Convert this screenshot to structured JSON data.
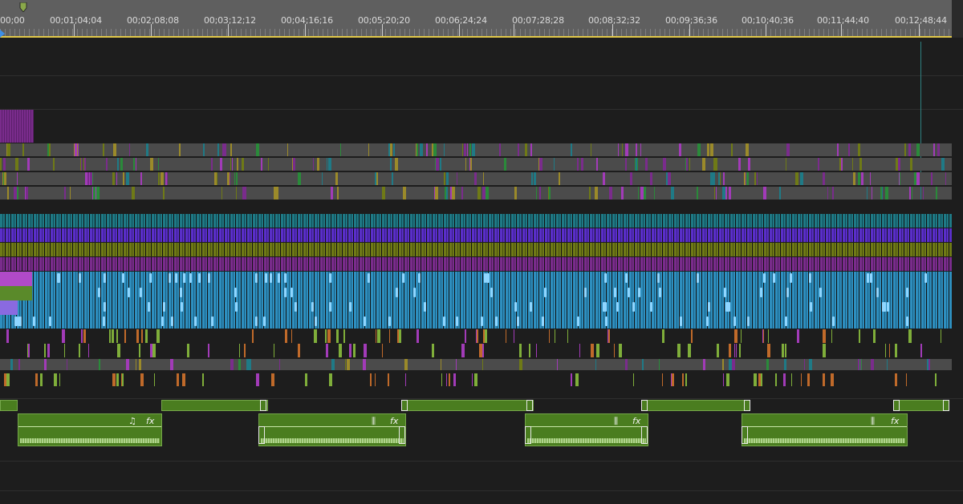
{
  "ruler": {
    "timecodes": [
      "00;00",
      "00;01;04;04",
      "00;02;08;08",
      "00;03;12;12",
      "00;04;16;16",
      "00;05;20;20",
      "00;06;24;24",
      "00;07;28;28",
      "00;08;32;32",
      "00;09;36;36",
      "00;10;40;36",
      "00;11;44;40",
      "00;12;48;44"
    ]
  },
  "colors": {
    "background": "#1d1d1d",
    "ruler": "#5f5f5f",
    "inout_bar": "#e1c84a",
    "playhead": "#3d8fe6",
    "track_gray": "#4b4b4b",
    "teal": "#1f7a86",
    "violet": "#5a2fc9",
    "olive": "#6f7a16",
    "magenta": "#7a2c8c",
    "light_blue": "#2e8fbf",
    "audio_green": "#4a7d1f"
  },
  "audio_clip_icons": {
    "music": "♫",
    "fx": "fx",
    "waveform": "waveform-icon"
  }
}
